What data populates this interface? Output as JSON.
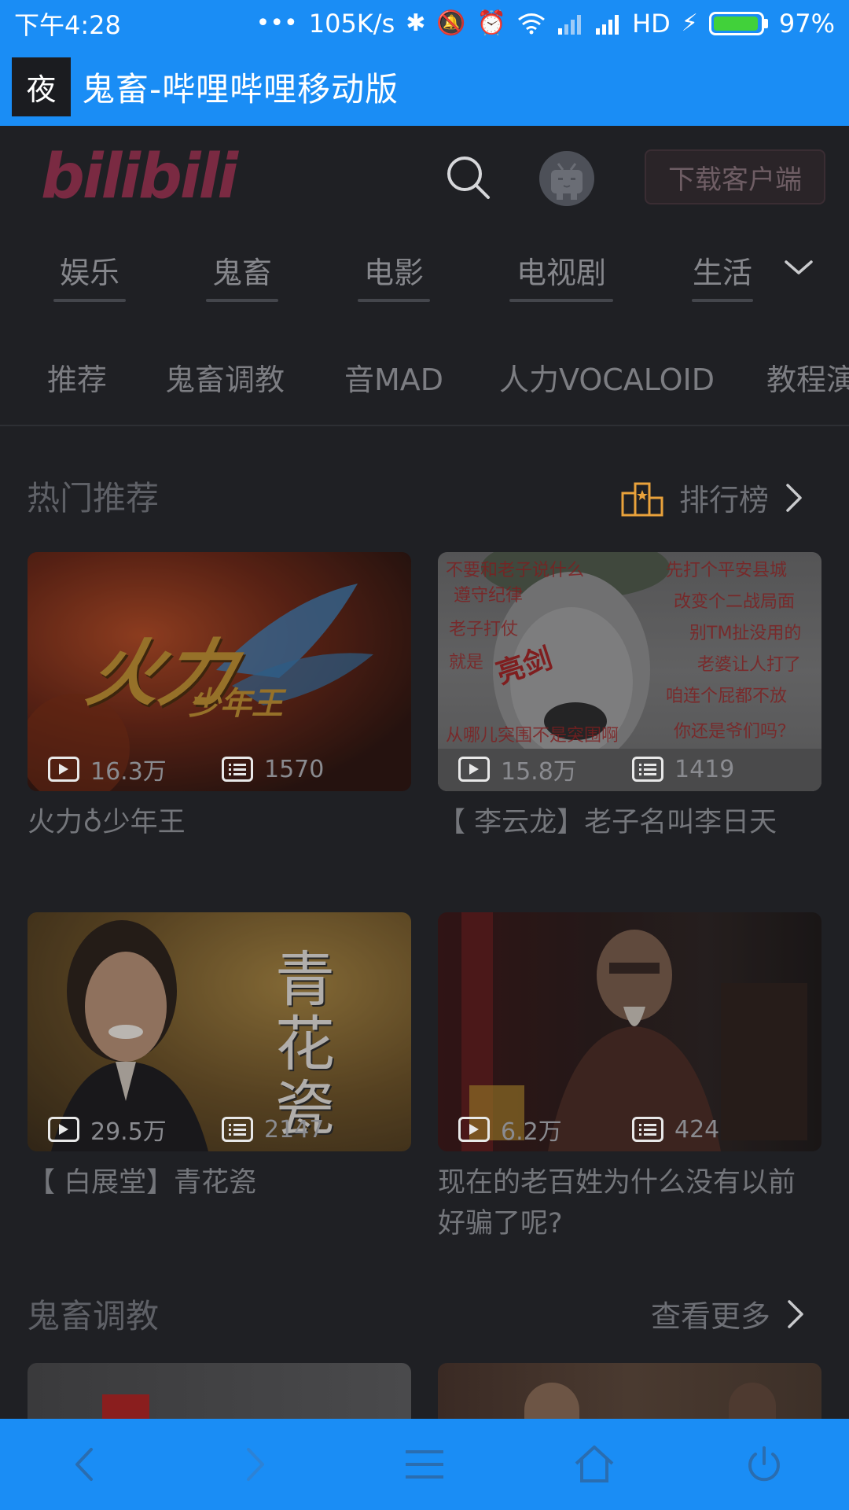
{
  "status_bar": {
    "time": "下午4:28",
    "dots": "•••",
    "net_speed": "105K/s",
    "network": "HD",
    "battery_level": 0.97,
    "battery_text": "97%"
  },
  "browser": {
    "night_badge": "夜",
    "title": "鬼畜-哔哩哔哩移动版"
  },
  "header": {
    "logo": "bilibili",
    "download_label": "下载客户端"
  },
  "main_nav": {
    "tabs": [
      {
        "label": "娱乐"
      },
      {
        "label": "鬼畜"
      },
      {
        "label": "电影"
      },
      {
        "label": "电视剧"
      },
      {
        "label": "生活"
      }
    ]
  },
  "sub_nav": {
    "items": [
      {
        "label": "推荐"
      },
      {
        "label": "鬼畜调教"
      },
      {
        "label": "音MAD"
      },
      {
        "label": "人力VOCALOID"
      },
      {
        "label": "教程演"
      }
    ]
  },
  "hot_section": {
    "title": "热门推荐",
    "link_label": "排行榜"
  },
  "videos": [
    {
      "views": "16.3万",
      "danmaku": "1570",
      "title": "火力♁少年王",
      "thumb_text": "火力",
      "thumb_sub": "少年王"
    },
    {
      "views": "15.8万",
      "danmaku": "1419",
      "title": "【 李云龙】老子名叫李日天"
    },
    {
      "views": "29.5万",
      "danmaku": "2147",
      "title": "【 白展堂】青花瓷",
      "thumb_text": "青花瓷"
    },
    {
      "views": "6.2万",
      "danmaku": "424",
      "title": "现在的老百姓为什么没有以前好骗了呢?"
    }
  ],
  "second_section": {
    "title": "鬼畜调教",
    "link_label": "查看更多"
  },
  "colors": {
    "accent": "#1a8df5",
    "background": "#1f2024",
    "rank_icon": "#e9a23b"
  }
}
